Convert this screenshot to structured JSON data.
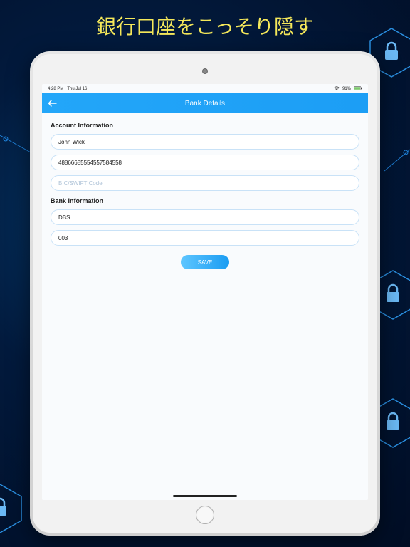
{
  "headline": "銀行口座をこっそり隠す",
  "statusbar": {
    "time": "4:28 PM",
    "date": "Thu Jul 16",
    "battery": "91%"
  },
  "navbar": {
    "title": "Bank Details"
  },
  "sections": {
    "account_title": "Account Information",
    "bank_title": "Bank Information"
  },
  "fields": {
    "name": "John Wick",
    "account_no": "488666855545575845​58",
    "bic_placeholder": "BIC/SWIFT Code",
    "bank_name": "DBS",
    "bank_code": "003"
  },
  "buttons": {
    "save": "SAVE"
  }
}
